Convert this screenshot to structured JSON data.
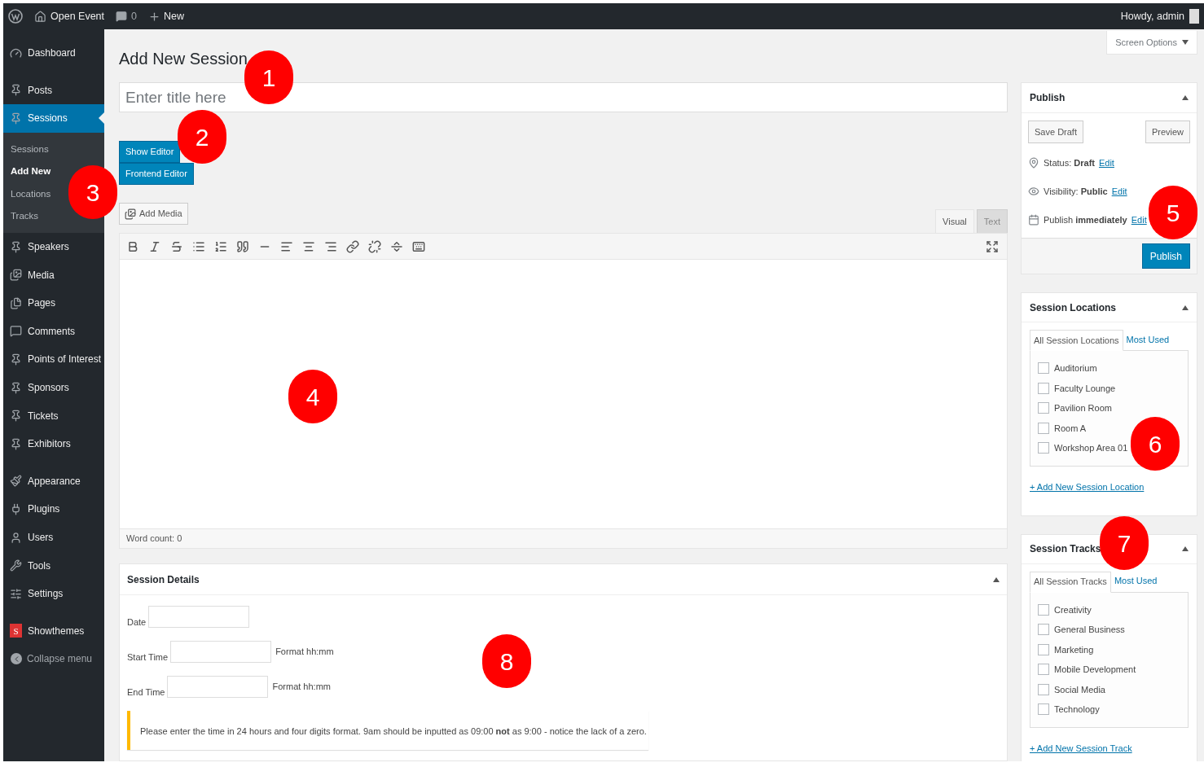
{
  "admin_bar": {
    "site": "Open Event",
    "comments": "0",
    "new": "New",
    "greeting": "Howdy, admin"
  },
  "sidebar": {
    "groups": [
      {
        "items": [
          {
            "label": "Dashboard",
            "selected": false
          }
        ]
      },
      {
        "items": [
          {
            "label": "Posts",
            "selected": false
          },
          {
            "label": "Sessions",
            "selected": true,
            "submenu": [
              {
                "label": "Sessions",
                "selected": false
              },
              {
                "label": "Add New",
                "selected": true
              },
              {
                "label": "Locations",
                "selected": false
              },
              {
                "label": "Tracks",
                "selected": false
              }
            ]
          },
          {
            "label": "Speakers",
            "selected": false
          },
          {
            "label": "Media",
            "selected": false
          },
          {
            "label": "Pages",
            "selected": false
          },
          {
            "label": "Comments",
            "selected": false
          },
          {
            "label": "Points of Interest",
            "selected": false
          },
          {
            "label": "Sponsors",
            "selected": false
          },
          {
            "label": "Tickets",
            "selected": false
          },
          {
            "label": "Exhibitors",
            "selected": false
          }
        ]
      },
      {
        "items": [
          {
            "label": "Appearance",
            "selected": false
          },
          {
            "label": "Plugins",
            "selected": false
          },
          {
            "label": "Users",
            "selected": false
          },
          {
            "label": "Tools",
            "selected": false
          },
          {
            "label": "Settings",
            "selected": false
          }
        ]
      },
      {
        "items": [
          {
            "label": "Showthemes",
            "selected": false,
            "logo_text": "S"
          }
        ]
      }
    ],
    "collapse": "Collapse menu"
  },
  "page_title": "Add New Session",
  "screen_options": "Screen Options",
  "title_field": {
    "placeholder": "Enter title here"
  },
  "editor_buttons": [
    "Show Editor",
    "Frontend Editor"
  ],
  "add_media": "Add Media",
  "editor_tabs": [
    {
      "label": "Visual",
      "selected": true
    },
    {
      "label": "Text",
      "selected": false
    }
  ],
  "word_count": "Word count: 0",
  "session_details": {
    "title": "Session Details",
    "fields": [
      {
        "label": "Date"
      },
      {
        "label": "Start Time",
        "hint": "Format hh:mm"
      },
      {
        "label": "End Time",
        "hint": "Format hh:mm"
      }
    ],
    "notice": "Please enter the time in 24 hours and four digits format. 9am should be inputted as 09:00 **not** as 9:00 - notice the lack of a zero."
  },
  "publish": {
    "title": "Publish",
    "save_draft": "Save Draft",
    "preview": "Preview",
    "rows": [
      {
        "text": "Status: **Draft**",
        "link": "Edit"
      },
      {
        "text": "Visibility: **Public**",
        "link": "Edit"
      },
      {
        "text": "Publish **immediately**",
        "link": "Edit"
      }
    ],
    "button": "Publish"
  },
  "taxonomy_boxes": [
    {
      "title": "Session Locations",
      "tabs": [
        {
          "label": "All Session Locations",
          "selected": true
        },
        {
          "label": "Most Used",
          "selected": false
        }
      ],
      "terms": [
        {
          "label": "Auditorium",
          "checked": false
        },
        {
          "label": "Faculty Lounge",
          "checked": false
        },
        {
          "label": "Pavilion Room",
          "checked": false
        },
        {
          "label": "Room A",
          "checked": false
        },
        {
          "label": "Workshop Area 01",
          "checked": false
        }
      ],
      "add_link": "+ Add New Session Location"
    },
    {
      "title": "Session Tracks",
      "tabs": [
        {
          "label": "All Session Tracks",
          "selected": true
        },
        {
          "label": "Most Used",
          "selected": false
        }
      ],
      "terms": [
        {
          "label": "Creativity",
          "checked": false
        },
        {
          "label": "General Business",
          "checked": false
        },
        {
          "label": "Marketing",
          "checked": false
        },
        {
          "label": "Mobile Development",
          "checked": false
        },
        {
          "label": "Social Media",
          "checked": false
        },
        {
          "label": "Technology",
          "checked": false
        }
      ],
      "add_link": "+ Add New Session Track"
    }
  ],
  "callouts": [
    {
      "label": "1"
    },
    {
      "label": "2"
    },
    {
      "label": "3"
    },
    {
      "label": "4"
    },
    {
      "label": "5"
    },
    {
      "label": "6"
    },
    {
      "label": "7"
    },
    {
      "label": "8"
    }
  ]
}
